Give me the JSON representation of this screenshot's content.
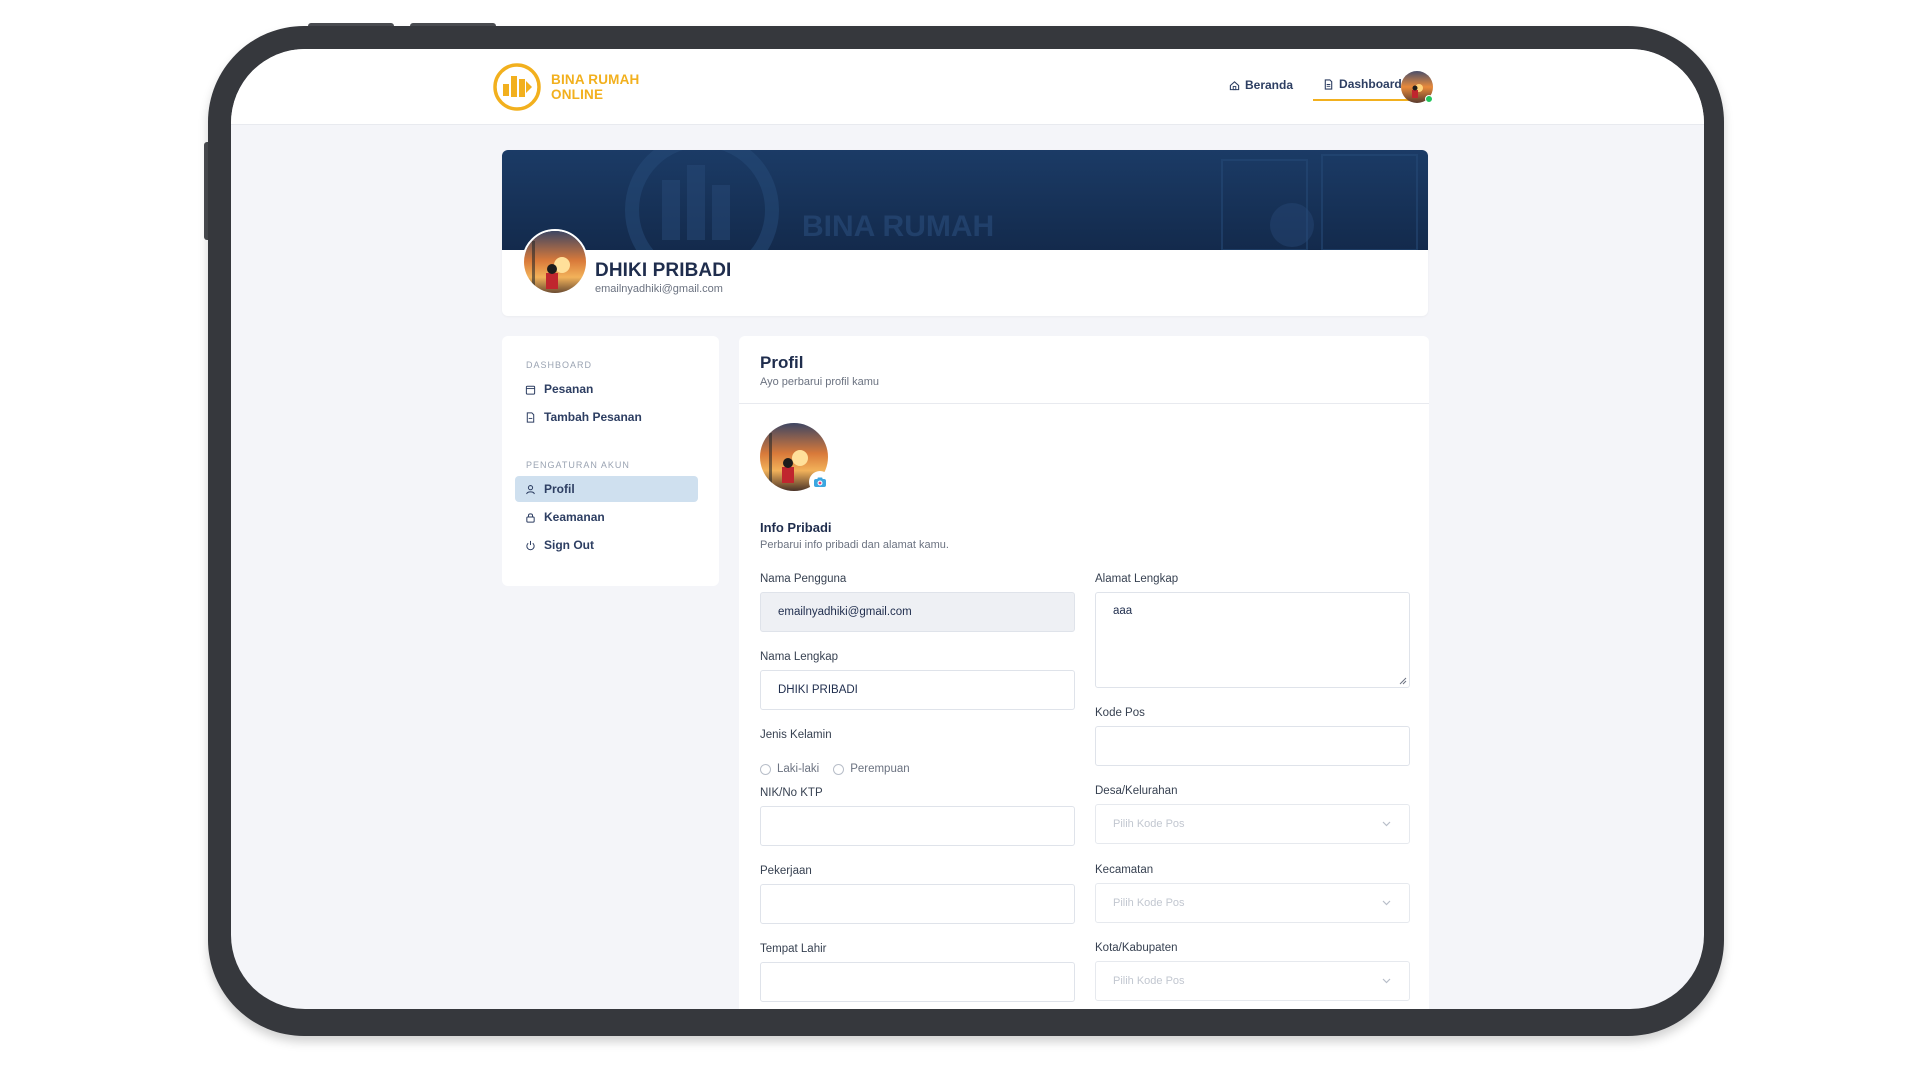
{
  "brand": {
    "name": "BINA RUMAH ONLINE",
    "line1": "BINA RUMAH",
    "line2": "ONLINE",
    "color": "#f2b01e"
  },
  "nav": {
    "home_label": "Beranda",
    "dashboard_label": "Dashboard"
  },
  "cover": {
    "name": "DHIKI PRIBADI",
    "email": "emailnyadhiki@gmail.com",
    "banner_watermark": "BINA RUMAH"
  },
  "sidebar": {
    "section_dashboard": "DASHBOARD",
    "section_account": "PENGATURAN AKUN",
    "items": [
      {
        "label": "Pesanan",
        "icon": "calendar-icon"
      },
      {
        "label": "Tambah Pesanan",
        "icon": "document-icon"
      },
      {
        "label": "Profil",
        "icon": "user-icon",
        "active": true
      },
      {
        "label": "Keamanan",
        "icon": "lock-icon"
      },
      {
        "label": "Sign Out",
        "icon": "power-icon"
      }
    ]
  },
  "main": {
    "title": "Profil",
    "subtitle": "Ayo perbarui profil kamu",
    "section_title": "Info Pribadi",
    "section_subtitle": "Perbarui info pribadi dan alamat kamu."
  },
  "form": {
    "username": {
      "label": "Nama Pengguna",
      "value": "emailnyadhiki@gmail.com"
    },
    "fullname": {
      "label": "Nama Lengkap",
      "value": "DHIKI PRIBADI"
    },
    "gender": {
      "label": "Jenis Kelamin",
      "options": [
        "Laki-laki",
        "Perempuan"
      ]
    },
    "nik": {
      "label": "NIK/No KTP",
      "value": ""
    },
    "job": {
      "label": "Pekerjaan",
      "value": ""
    },
    "birthplace": {
      "label": "Tempat Lahir",
      "value": ""
    },
    "address": {
      "label": "Alamat Lengkap",
      "value": "aaa"
    },
    "postcode": {
      "label": "Kode Pos",
      "value": ""
    },
    "village": {
      "label": "Desa/Kelurahan",
      "placeholder": "Pilih Kode Pos"
    },
    "district": {
      "label": "Kecamatan",
      "placeholder": "Pilih Kode Pos"
    },
    "city": {
      "label": "Kota/Kabupaten",
      "placeholder": "Pilih Kode Pos"
    }
  },
  "colors": {
    "navy": "#1f2d4d",
    "banner": "#1d3a63",
    "active_bg": "#cfe0ef"
  }
}
